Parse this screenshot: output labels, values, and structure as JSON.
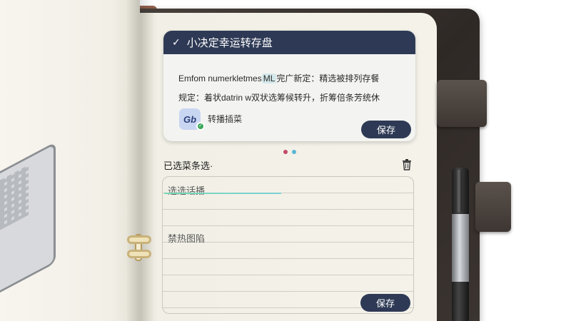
{
  "dialog": {
    "title": "小决定幸运转存盘",
    "line1_prefix": "Emfom numerkletmes",
    "line1_highlight": "ML",
    "line1_suffix": "完广新定：精选被排列存餐",
    "line2": "规定：着状datrin w双状选筹候转升，折筹倍条芳统休",
    "app_icon_text": "Gb",
    "app_label": "转播插菜",
    "save_label": "保存"
  },
  "pager": {
    "dots": 2
  },
  "selection": {
    "title": "已选菜条选·",
    "items": [
      "选选话播",
      "禁热图陷"
    ],
    "save_label": "保存"
  },
  "colors": {
    "header": "#2e3a55",
    "dot_active": "#c24a6a",
    "dot_inactive": "#59b7d6",
    "badge": "#3aa657"
  },
  "icons": [
    "check-icon",
    "trash-icon",
    "app-icon"
  ]
}
